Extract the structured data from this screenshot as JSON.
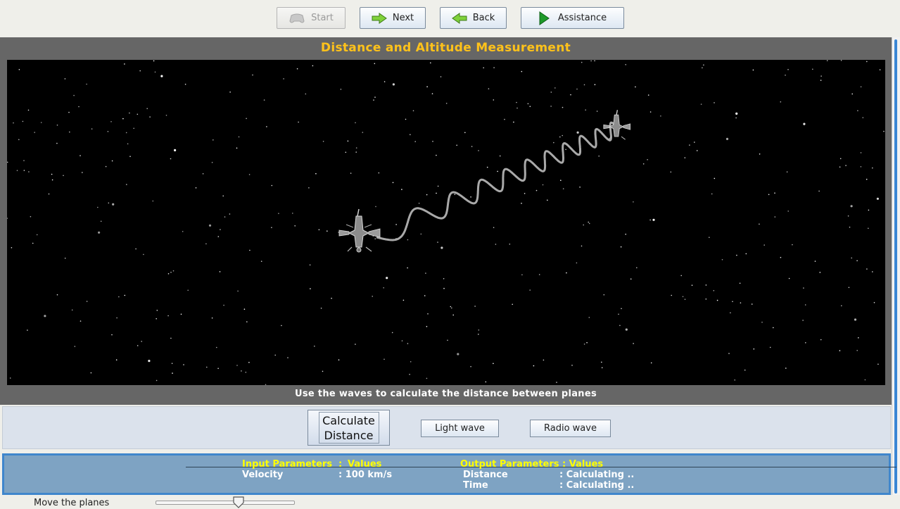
{
  "toolbar": {
    "start_label": "Start",
    "next_label": "Next",
    "back_label": "Back",
    "assistance_label": "Assistance"
  },
  "panel": {
    "title": "Distance and Altitude Measurement",
    "instruction": "Use the waves to calculate the distance between planes"
  },
  "controls": {
    "calculate_line1": "Calculate",
    "calculate_line2": "Distance",
    "light_wave_label": "Light wave",
    "radio_wave_label": "Radio wave"
  },
  "parameters": {
    "input_header": "Input Parameters",
    "input_header_sep": ":",
    "input_header_values": "Values",
    "output_header": "Output Parameters : Values",
    "velocity_label": "Velocity",
    "velocity_value": ": 100 km/s",
    "distance_label": "Distance",
    "distance_value": ": Calculating ..",
    "time_label": "Time",
    "time_value": ": Calculating .."
  },
  "slider": {
    "label": "Move the planes",
    "value_fraction": 0.6
  },
  "colors": {
    "title": "#ffc21a",
    "param_header": "#ffff00",
    "param_panel": "#7ea3c3",
    "accent_border": "#3f86cc"
  }
}
